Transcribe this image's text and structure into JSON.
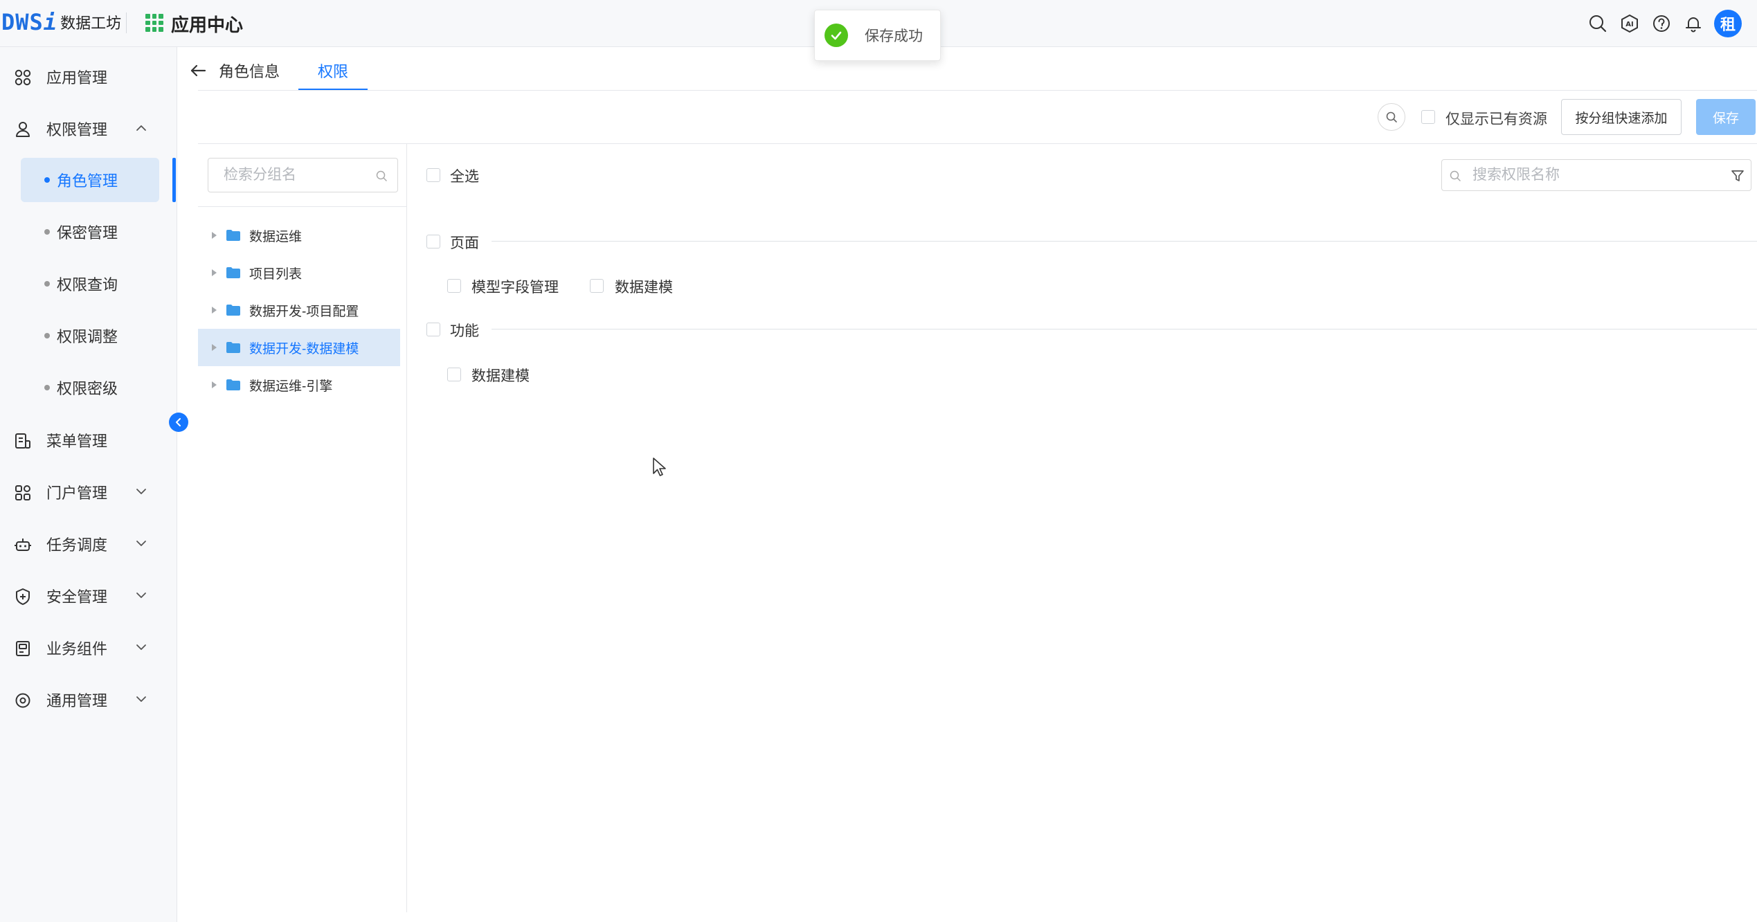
{
  "header": {
    "logo_mark": "DWS",
    "logo_mark_i": "i",
    "logo_text": "数据工坊",
    "app_title": "应用中心",
    "icons": [
      "search-icon",
      "ai-icon",
      "help-icon",
      "bell-icon"
    ],
    "avatar_text": "租"
  },
  "toast": {
    "message": "保存成功",
    "color": "#52c41a"
  },
  "sidebar": {
    "items": [
      {
        "label": "应用管理",
        "icon": "apps-icon"
      },
      {
        "label": "权限管理",
        "icon": "user-lock-icon",
        "expanded": true
      },
      {
        "label": "菜单管理",
        "icon": "menu-icon"
      },
      {
        "label": "门户管理",
        "icon": "portal-icon"
      },
      {
        "label": "任务调度",
        "icon": "robot-icon"
      },
      {
        "label": "安全管理",
        "icon": "shield-icon"
      },
      {
        "label": "业务组件",
        "icon": "component-icon"
      },
      {
        "label": "通用管理",
        "icon": "settings-icon"
      }
    ],
    "sub_items": [
      {
        "label": "角色管理",
        "active": true
      },
      {
        "label": "保密管理"
      },
      {
        "label": "权限查询"
      },
      {
        "label": "权限调整"
      },
      {
        "label": "权限密级"
      }
    ]
  },
  "tabs": {
    "info_label": "角色信息",
    "perm_label": "权限"
  },
  "toolbar": {
    "only_existing_label": "仅显示已有资源",
    "group_add_label": "按分组快速添加",
    "save_label": "保存"
  },
  "tree": {
    "search_placeholder": "检索分组名",
    "nodes": [
      {
        "label": "数据运维"
      },
      {
        "label": "项目列表"
      },
      {
        "label": "数据开发-项目配置"
      },
      {
        "label": "数据开发-数据建模",
        "active": true
      },
      {
        "label": "数据运维-引擎"
      }
    ]
  },
  "permissions": {
    "select_all_label": "全选",
    "search_placeholder": "搜索权限名称",
    "sections": [
      {
        "label": "页面",
        "items": [
          "模型字段管理",
          "数据建模"
        ]
      },
      {
        "label": "功能",
        "items": [
          "数据建模"
        ]
      }
    ]
  },
  "colors": {
    "accent": "#1677ff",
    "active_bg": "#dce9f8",
    "save_disabled": "#8cc2fa"
  }
}
